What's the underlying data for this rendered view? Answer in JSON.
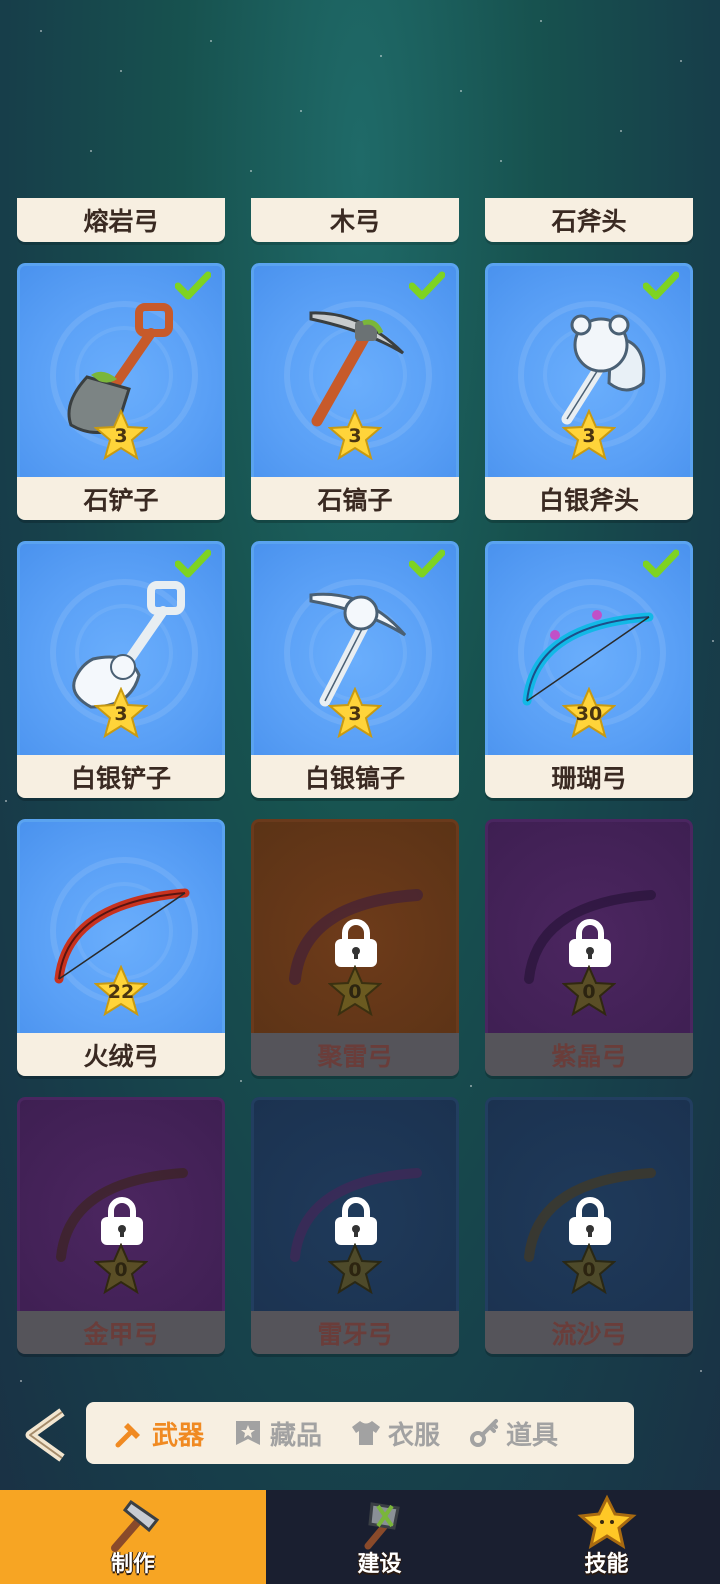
{
  "top_labels": [
    "熔岩弓",
    "木弓",
    "石斧头"
  ],
  "cards": [
    {
      "name": "石铲子",
      "stars": "3",
      "unlocked": true,
      "checked": true,
      "icon": "shovel-icon"
    },
    {
      "name": "石镐子",
      "stars": "3",
      "unlocked": true,
      "checked": true,
      "icon": "pickaxe-icon"
    },
    {
      "name": "白银斧头",
      "stars": "3",
      "unlocked": true,
      "checked": true,
      "icon": "silver-axe-icon"
    },
    {
      "name": "白银铲子",
      "stars": "3",
      "unlocked": true,
      "checked": true,
      "icon": "silver-shovel-icon"
    },
    {
      "name": "白银镐子",
      "stars": "3",
      "unlocked": true,
      "checked": true,
      "icon": "silver-pickaxe-icon"
    },
    {
      "name": "珊瑚弓",
      "stars": "30",
      "unlocked": true,
      "checked": true,
      "icon": "coral-bow-icon"
    },
    {
      "name": "火绒弓",
      "stars": "22",
      "unlocked": true,
      "checked": false,
      "icon": "tinder-bow-icon"
    },
    {
      "name": "聚雷弓",
      "stars": "0",
      "unlocked": false,
      "theme": "brown",
      "icon": "thunder-bow-icon"
    },
    {
      "name": "紫晶弓",
      "stars": "0",
      "unlocked": false,
      "theme": "purple",
      "icon": "amethyst-bow-icon"
    },
    {
      "name": "金甲弓",
      "stars": "0",
      "unlocked": false,
      "theme": "purple",
      "icon": "golden-bow-icon"
    },
    {
      "name": "雷牙弓",
      "stars": "0",
      "unlocked": false,
      "theme": "navy",
      "icon": "thunder-fang-bow-icon"
    },
    {
      "name": "流沙弓",
      "stars": "0",
      "unlocked": false,
      "theme": "navy",
      "icon": "quicksand-bow-icon"
    }
  ],
  "tabs": [
    {
      "label": "武器",
      "icon": "hammer-icon",
      "active": true
    },
    {
      "label": "藏品",
      "icon": "bookmark-icon",
      "active": false
    },
    {
      "label": "衣服",
      "icon": "shirt-icon",
      "active": false
    },
    {
      "label": "道具",
      "icon": "key-icon",
      "active": false
    }
  ],
  "bottom_nav": [
    {
      "label": "制作",
      "icon": "craft-hammer-icon",
      "active": true
    },
    {
      "label": "建设",
      "icon": "build-hammer-icon",
      "active": false
    },
    {
      "label": "技能",
      "icon": "skill-star-icon",
      "active": false
    }
  ],
  "colors": {
    "accent": "#f08a22",
    "card_blue": "#5aa0f6",
    "label_bg": "#f7efe1",
    "nav_active": "#f7a523"
  }
}
